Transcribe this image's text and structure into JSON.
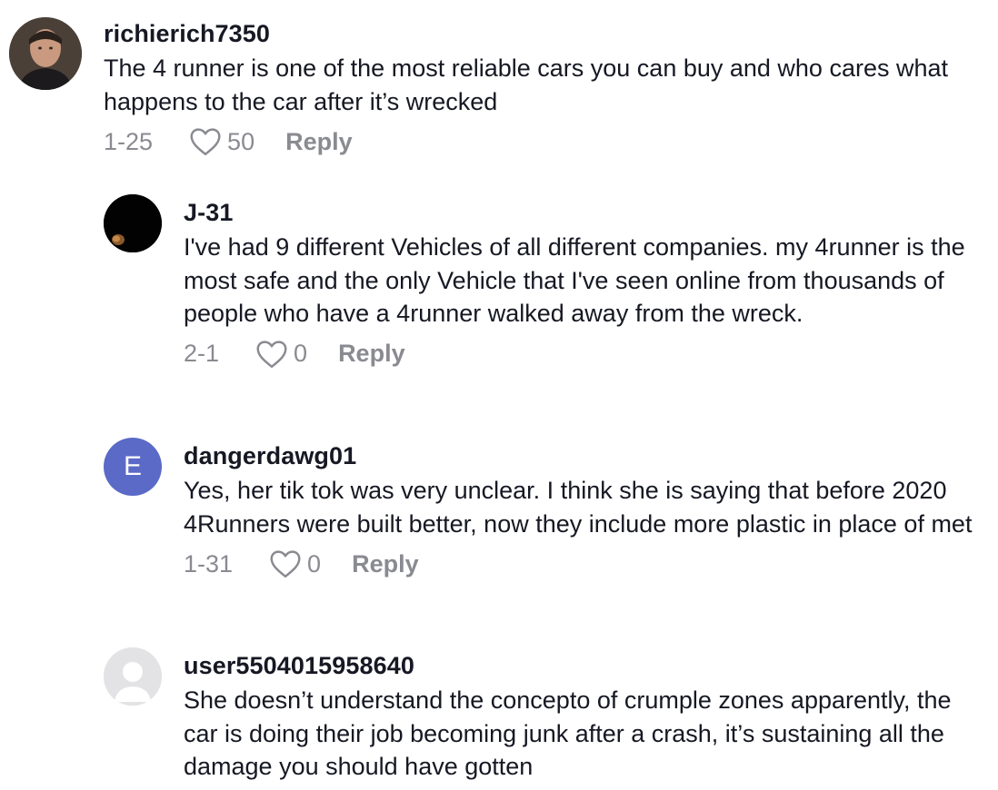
{
  "comments": [
    {
      "username": "richierich7350",
      "text": "The 4 runner is one of the most reliable cars you can buy and who cares what happens to the car after it’s wrecked",
      "date": "1-25",
      "likes": "50",
      "reply_label": "Reply",
      "avatar": "photo"
    },
    {
      "username": "J-31",
      "text": "I've had 9 different Vehicles of all different companies. my 4runner is the most safe and the only Vehicle that I've seen online from thousands of people who have a 4runner walked away from the wreck.",
      "date": "2-1",
      "likes": "0",
      "reply_label": "Reply",
      "avatar": "dark-photo"
    },
    {
      "username": "dangerdawg01",
      "text": "Yes, her tik tok was very unclear. I think she is saying that before 2020 4Runners were built better, now they include more plastic in place of met",
      "date": "1-31",
      "likes": "0",
      "reply_label": "Reply",
      "avatar_letter": "E",
      "avatar_color": "#5b6ac7"
    },
    {
      "username": "user5504015958640",
      "text": "She doesn’t understand the concepto of crumple zones apparently, the car is doing their job becoming junk after a crash, it’s sustaining all the damage you should have gotten",
      "avatar": "default-user-icon",
      "avatar_color": "#e3e3e5"
    }
  ],
  "colors": {
    "text_primary": "#161823",
    "text_secondary": "#8a8b91"
  }
}
